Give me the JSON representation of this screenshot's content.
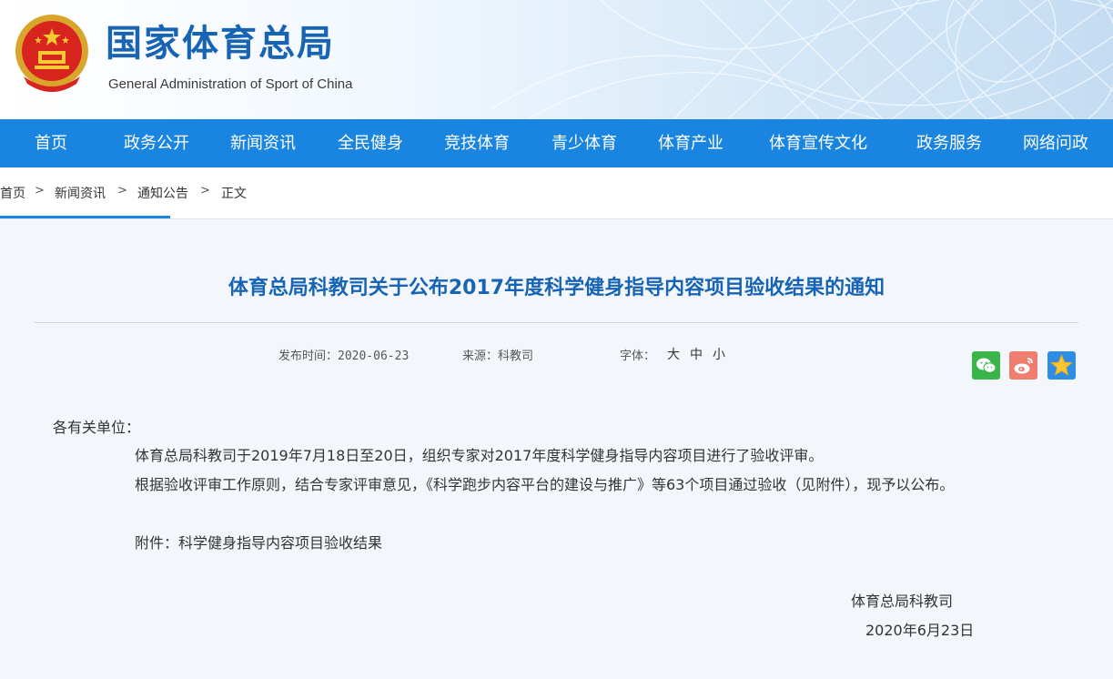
{
  "header": {
    "title": "国家体育总局",
    "subtitle": "General Administration of Sport of China"
  },
  "nav": {
    "items": [
      "首页",
      "政务公开",
      "新闻资讯",
      "全民健身",
      "竞技体育",
      "青少体育",
      "体育产业",
      "体育宣传文化",
      "政务服务",
      "网络问政"
    ]
  },
  "breadcrumb": {
    "items": [
      "首页",
      "新闻资讯",
      "通知公告",
      "正文"
    ],
    "separator": ">"
  },
  "article": {
    "title": "体育总局科教司关于公布2017年度科学健身指导内容项目验收结果的通知",
    "publish_label": "发布时间：2020-06-23",
    "source_label": "来源：科教司",
    "font_size_label": "字体：",
    "font_sizes": [
      "大",
      "中",
      "小"
    ],
    "salutation": "各有关单位：",
    "paragraphs": [
      "体育总局科教司于2019年7月18日至20日，组织专家对2017年度科学健身指导内容项目进行了验收评审。",
      "根据验收评审工作原则，结合专家评审意见，《科学跑步内容平台的建设与推广》等63个项目通过验收（见附件），现予以公布。"
    ],
    "attachment": "附件：科学健身指导内容项目验收结果",
    "signature_org": "体育总局科教司",
    "signature_date": "2020年6月23日"
  },
  "share": {
    "icons": [
      "wechat-icon",
      "weibo-icon",
      "qzone-icon"
    ],
    "colors": {
      "wechat": "#3ab54a",
      "weibo": "#f07e6e",
      "qzone": "#2e8de6"
    }
  },
  "colors": {
    "nav_bg": "#1a85e0",
    "title": "#1763b4",
    "page_bg": "#f3f7fc"
  }
}
